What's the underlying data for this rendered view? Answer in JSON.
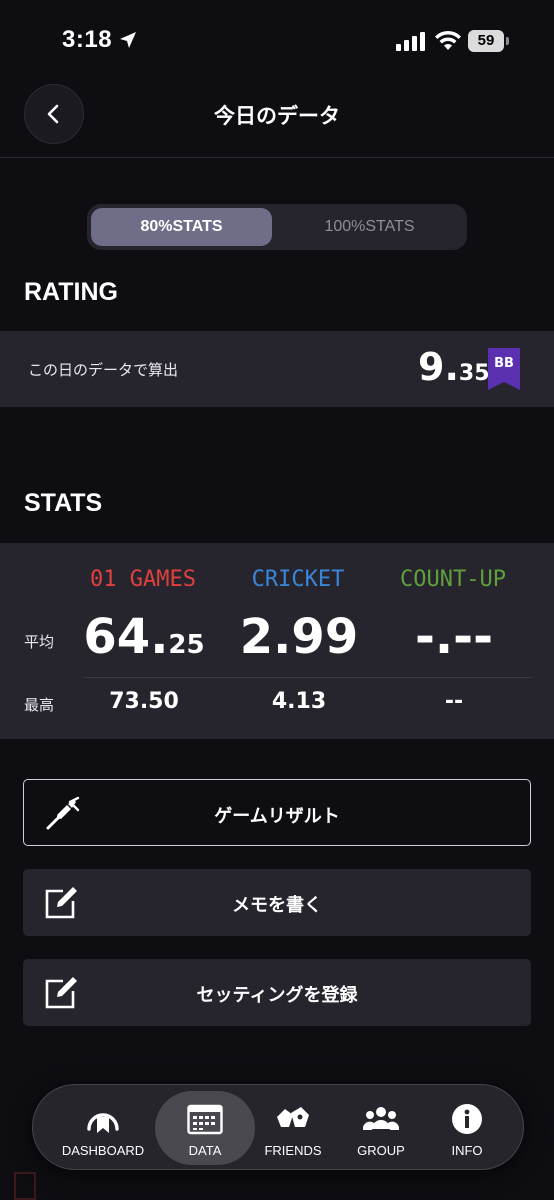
{
  "status_bar": {
    "time": "3:18",
    "battery": "59",
    "icons": [
      "location-arrow-icon",
      "cellular-signal-icon",
      "wifi-icon",
      "battery-icon"
    ]
  },
  "header": {
    "title": "今日のデータ",
    "back_icon": "chevron-left-icon"
  },
  "stats_toggle": {
    "options": [
      "80%STATS",
      "100%STATS"
    ],
    "selected": "80%STATS"
  },
  "rating": {
    "section_title": "RATING",
    "label": "この日のデータで算出",
    "value_int": "9.",
    "value_dec": "35",
    "badge": "BB",
    "badge_color": "#5a2fb0"
  },
  "stats": {
    "section_title": "STATS",
    "columns": [
      {
        "name": "01 GAMES",
        "color": "#e0403f",
        "avg_int": "64.",
        "avg_dec": "25",
        "max": "73.50"
      },
      {
        "name": "CRICKET",
        "color": "#3a86d8",
        "avg_int": "2.99",
        "avg_dec": "",
        "max": "4.13"
      },
      {
        "name": "COUNT-UP",
        "color": "#5fa03b",
        "avg_int": "-.--",
        "avg_dec": "",
        "max": "--"
      }
    ],
    "row_labels": {
      "avg": "平均",
      "max": "最高"
    }
  },
  "actions": [
    {
      "label": "ゲームリザルト",
      "icon": "dart-icon"
    },
    {
      "label": "メモを書く",
      "icon": "edit-note-icon"
    },
    {
      "label": "セッティングを登録",
      "icon": "edit-note-icon"
    }
  ],
  "tabbar": {
    "tabs": [
      {
        "label": "DASHBOARD",
        "icon": "dashboard-gauge-icon"
      },
      {
        "label": "DATA",
        "icon": "calendar-icon"
      },
      {
        "label": "FRIENDS",
        "icon": "friends-icon"
      },
      {
        "label": "GROUP",
        "icon": "group-icon"
      },
      {
        "label": "INFO",
        "icon": "info-icon"
      }
    ],
    "active": "DATA"
  }
}
